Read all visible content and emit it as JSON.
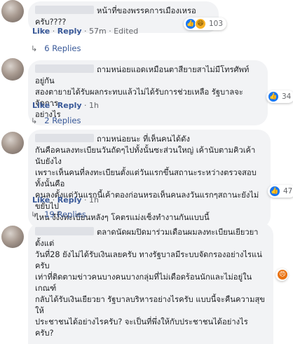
{
  "comments": [
    {
      "text": "หน้าที่ของพรรคการเมืองเหรอครับ????",
      "reaction_count": "103",
      "reaction_icons": [
        "like-icon",
        "haha-icon"
      ],
      "actions": {
        "like": "Like",
        "reply": "Reply",
        "time": "57m",
        "edited": "Edited"
      },
      "replies": "6 Replies"
    },
    {
      "lines": [
        "ถามหน่อยแอดเหมือนตาสียายสาไม่มีโทรศัพท์ อยู่กัน",
        "สองตายายได้รับผลกระทบแล้วไม่ได้รับการช่วยเหลือ รัฐบาลจะจัดการ",
        "อย่างไร"
      ],
      "reaction_count": "34",
      "reaction_icons": [
        "like-icon"
      ],
      "actions": {
        "like": "Like",
        "reply": "Reply",
        "time": "1h"
      },
      "replies": "2 Replies"
    },
    {
      "lines": [
        "ถามหน่อยนะ ที่เห็นคนได้ดัง",
        "กันคือคนลงทะเบียนวันถัดๆไปทั้งนั้นซะส่วนใหญ่ เค้านับตามคิวเค้านับยังไง",
        "เพราะเห็นคนที่ลงทะเบียนตั้งแต่วันแรกขึ้นสถานะระหว่างตรวจสอบทั้งนั้นคือ",
        "คนลงตั้งแต่วันแรกนี้เค้าตองก่อนหรอเห็นคนลงวันแรกๆสถานะยังไม่ขยับไป",
        "ไหน งึงั้งทะเบียนหลังๆ โคตรแม่งเซ็งทำงานกันแบบนี้"
      ],
      "reaction_count": "47",
      "reaction_icons": [
        "like-icon"
      ],
      "actions": {
        "like": "Like",
        "reply": "Reply",
        "time": "1h"
      },
      "replies": "19 Replies"
    },
    {
      "lines": [
        "ตลาดนัดผมปิดมาร่วมเดือนผมลงทะเบียนเยียวยาตั้งแต่",
        "วันที่28 ยังไม่ได้รับเงินเลยครับ ทางรัฐบาลมีระบบจัดกรองอย่างไรแน่ครับ",
        "เท่าที่ติดตามข่าวคนบางคนบางกลุ่มที่ไม่เดือดร้อนนักและไม่อยู่ในเกณฑ์",
        "กลับได้รับเงินเยียวยา รัฐบาลบริหารอย่างไรครับ แบบนี้จะคืนความสุขให้",
        "ประชาชนได้อย่างไรครับ? จะเป็นที่พึ่งให้กับประชาชนได้อย่างไรครับ?"
      ],
      "reaction_icons": [
        "angry-icon"
      ]
    }
  ]
}
